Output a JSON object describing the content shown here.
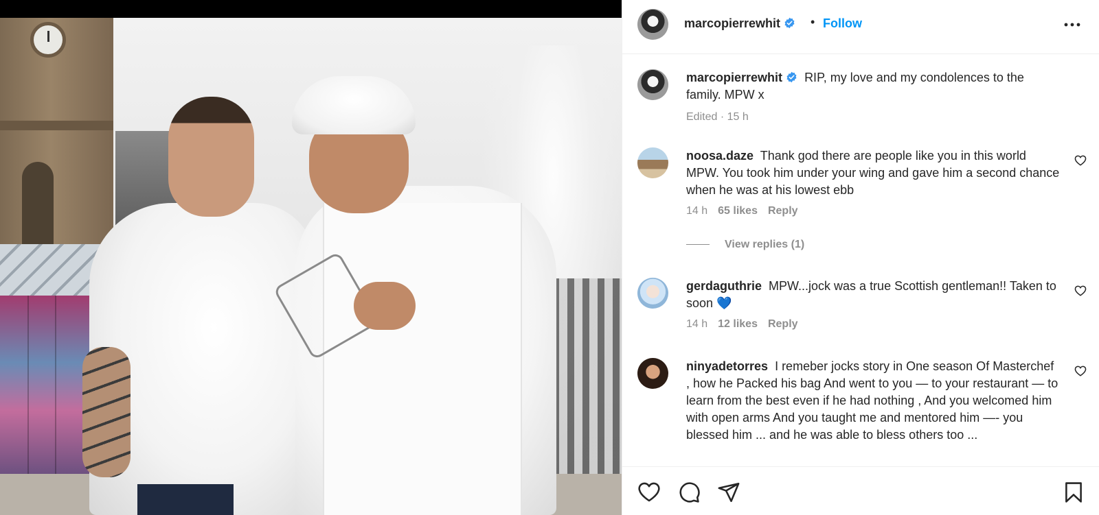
{
  "post": {
    "username": "marcopierrewhit",
    "dot": "•",
    "follow_label": "Follow",
    "caption": "RIP, my love and my condolences to the family. MPW x",
    "caption_meta": "Edited · 15 h"
  },
  "comments": [
    {
      "username": "noosa.daze",
      "text": "Thank god there are people like you in this world MPW. You took him under your wing and gave him a second chance when he was at his lowest ebb",
      "time": "14 h",
      "likes": "65 likes",
      "reply_label": "Reply",
      "view_replies": "View replies (1)"
    },
    {
      "username": "gerdaguthrie",
      "text": "MPW...jock was a true Scottish gentleman!! Taken to soon 💙",
      "time": "14 h",
      "likes": "12 likes",
      "reply_label": "Reply"
    },
    {
      "username": "ninyadetorres",
      "text": "I remeber jocks story in One season Of Masterchef , how he Packed his bag And went to you — to your restaurant — to learn from the best even if he had nothing , And you welcomed him with open arms And you taught me and mentored him —- you blessed him ... and he was able to bless others too ..."
    }
  ],
  "icons": {
    "verified": "verified-badge-icon",
    "more": "more-options-icon",
    "like": "heart-icon",
    "comment": "comment-bubble-icon",
    "share": "paper-plane-icon",
    "save": "bookmark-icon"
  },
  "colors": {
    "accent": "#0095f6",
    "text": "#262626",
    "secondary": "#8e8e8e",
    "verified": "#3897f0"
  }
}
